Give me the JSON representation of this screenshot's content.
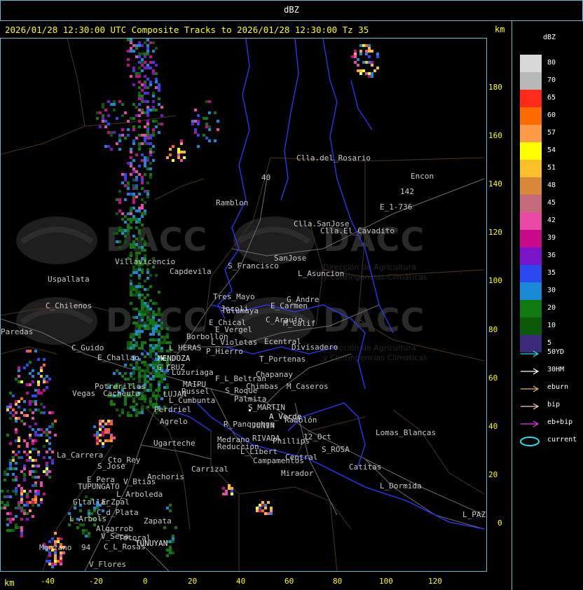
{
  "header": {
    "title": "dBZ"
  },
  "map_header": {
    "subtitle": "2026/01/28 12:30:00 UTC Composite Tracks to 2026/01/28 12:30:00 Tz 35",
    "km_top": "km",
    "km_bottom": "km"
  },
  "legend": {
    "title": "dBZ",
    "items": [
      {
        "label": "80",
        "color": "#d8d8d8"
      },
      {
        "label": "70",
        "color": "#b9b9b9"
      },
      {
        "label": "65",
        "color": "#ff2a1a"
      },
      {
        "label": "60",
        "color": "#ff6a00"
      },
      {
        "label": "57",
        "color": "#ff9a4a"
      },
      {
        "label": "54",
        "color": "#ffff00"
      },
      {
        "label": "51",
        "color": "#f9c02a"
      },
      {
        "label": "48",
        "color": "#d88a3a"
      },
      {
        "label": "45",
        "color": "#c46a7a"
      },
      {
        "label": "42",
        "color": "#e84aa6"
      },
      {
        "label": "39",
        "color": "#c80a8a"
      },
      {
        "label": "36",
        "color": "#7a14c8"
      },
      {
        "label": "35",
        "color": "#2a4af0"
      },
      {
        "label": "30",
        "color": "#1a8ad8"
      },
      {
        "label": "20",
        "color": "#107a10"
      },
      {
        "label": "10",
        "color": "#0a5a0a"
      },
      {
        "label": "5",
        "color": "#3a2a7a"
      }
    ]
  },
  "tracks": [
    {
      "label": "50YD",
      "color": "#2ae0e8"
    },
    {
      "label": "30HM",
      "color": "#ffffff"
    },
    {
      "label": "eburn",
      "color": "#e8b46a"
    },
    {
      "label": "bip",
      "color": "#f5c8c8"
    },
    {
      "label": "eb+bip",
      "color": "#e040e0"
    },
    {
      "label": "current",
      "color": "#2ae0e8"
    }
  ],
  "axes": {
    "y": [
      "180",
      "160",
      "140",
      "120",
      "100",
      "80",
      "60",
      "40",
      "20",
      "0"
    ],
    "x": [
      "-40",
      "-20",
      "0",
      "20",
      "40",
      "60",
      "80",
      "100",
      "120"
    ]
  },
  "watermark": {
    "text": "DACC",
    "subtitle_line1": "Dirección de Agricultura",
    "subtitle_line2": "y Contingencias Climáticas"
  },
  "places": [
    "Clla.del_Rosario",
    "Encon",
    "142",
    "E_1-736",
    "Ramblon",
    "40",
    "Clla.SanJose",
    "Clla.El_Cavadito",
    "Villavicencio",
    "Capdevila",
    "S_Francisco",
    "SanJose",
    "Uspallata",
    "L_Asuncion",
    "Tres_Mayo",
    "Jocoli",
    "G_Andre",
    "C_Chilenos",
    "Tulumaya",
    "E_Carmen",
    "Paredas",
    "E_Chical",
    "C_Araujo",
    "M_Calif",
    "E_Vergel",
    "Borbollon",
    "Ecentral",
    "Divisadero",
    "C_Guido",
    "L_Violetas",
    "L_HERAS",
    "P_Hierro",
    "E_Challao",
    "MENDOZA",
    "T_Portenas",
    "G_CRUZ",
    "Luzuriaga",
    "Chapanay",
    "F_L_Beltran",
    "Potrerillos",
    "MAIPU",
    "Chimbas",
    "M_Caseros",
    "Vegas",
    "Cacheuta",
    "LUJAN",
    "Russel",
    "S_Roque",
    "L_Cumbunta",
    "Palmita",
    "Perdriel",
    "S_MARTIN",
    "A_Verde",
    "Ramblón",
    "Agrelo",
    "R_Panquehua",
    "JUNIN",
    "Lomas_Blancas",
    "Ugarteche",
    "Medrano",
    "RIVADA",
    "Phillips",
    "12_Oct",
    "Reduccion",
    "S_ROSA",
    "L_Libert",
    "Central",
    "La_Carrera",
    "Cto_Rey",
    "Campamentos",
    "Catitas",
    "S_Jose",
    "Carrizal",
    "E_Pera",
    "V_Btias",
    "Anchoris",
    "Mirador",
    "TUPUNGATO",
    "L_Dormida",
    "L_Arboleda",
    "Gltallar",
    "E_Zpal",
    "C_d_Plata",
    "L_Arbols",
    "Zapata",
    "Algarrob",
    "V_Seca",
    "Totoral",
    "TUNUYAN",
    "C_L_Rosas",
    "Manzano",
    "V_Flores",
    "L_PAZ",
    "94"
  ]
}
